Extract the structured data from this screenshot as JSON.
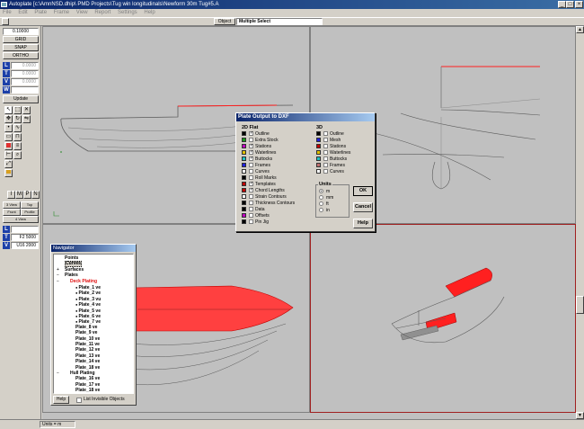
{
  "window": {
    "title": "Autoplate [c:\\AmnNSD.dhip\\ PMD Projects\\Tug win longitudinals\\Newform 30m Tug#5.A",
    "controls": [
      "_",
      "□",
      "×"
    ]
  },
  "menu": [
    "File",
    "Edit",
    "Plate",
    "Frame",
    "View",
    "Report",
    "Settings",
    "Help"
  ],
  "toolbar": {
    "object_label": "Object",
    "select_mode": "Multiple Select"
  },
  "left_panel": {
    "grid_value": "0.10000",
    "grid_label": "GRID",
    "snap_label": "SNAP",
    "ortho_label": "ORTHO",
    "axes": [
      {
        "label": "L",
        "value": "0.0000"
      },
      {
        "label": "T",
        "value": "0.0000"
      },
      {
        "label": "V",
        "value": "0.0000"
      },
      {
        "label": "W",
        "value": ""
      }
    ],
    "update_label": "Update",
    "view_buttons": [
      "I",
      "M",
      "P",
      "N"
    ],
    "views": [
      "3 View",
      "Top",
      "Front",
      "Profile",
      "4 View"
    ],
    "bottom_axes": [
      {
        "label": "L",
        "value": ""
      },
      {
        "label": "T",
        "value": "F2 5000"
      },
      {
        "label": "V",
        "value": "U16 2000"
      }
    ]
  },
  "dialog": {
    "title": "Plate Output to DXF",
    "group_2d": "2D Flat",
    "group_3d": "3D",
    "items_2d": [
      {
        "label": "Outline",
        "checked": true,
        "color": "#000000"
      },
      {
        "label": "Extra Stock",
        "checked": false,
        "color": "#1a9a1a"
      },
      {
        "label": "Stations",
        "checked": true,
        "color": "#c000c0"
      },
      {
        "label": "Waterlines",
        "checked": true,
        "color": "#e0c000"
      },
      {
        "label": "Buttocks",
        "checked": true,
        "color": "#20c0c0"
      },
      {
        "label": "Frames",
        "checked": false,
        "color": "#2020e0"
      },
      {
        "label": "Curves",
        "checked": false,
        "color": "#ffffff"
      },
      {
        "label": "Roll Marks",
        "checked": false,
        "color": "#000000"
      },
      {
        "label": "Templates",
        "checked": true,
        "color": "#c00000"
      },
      {
        "label": "Chord Lengths",
        "checked": true,
        "color": "#c00000"
      },
      {
        "label": "Strain Contours",
        "checked": false,
        "color": "#ffffff"
      },
      {
        "label": "Thickness Contours",
        "checked": false,
        "color": "#000000"
      },
      {
        "label": "Data",
        "checked": false,
        "color": "#000000"
      },
      {
        "label": "Offsets",
        "checked": false,
        "color": "#c000c0"
      },
      {
        "label": "Pin Jig",
        "checked": false,
        "color": "#000000"
      }
    ],
    "items_3d": [
      {
        "label": "Outline",
        "checked": false,
        "color": "#000000"
      },
      {
        "label": "Mesh",
        "checked": false,
        "color": "#2020e0"
      },
      {
        "label": "Stations",
        "checked": false,
        "color": "#c00000"
      },
      {
        "label": "Waterlines",
        "checked": false,
        "color": "#e0c000"
      },
      {
        "label": "Buttocks",
        "checked": false,
        "color": "#20c0c0"
      },
      {
        "label": "Frames",
        "checked": false,
        "color": "#c07070"
      },
      {
        "label": "Curves",
        "checked": false,
        "color": "#ffffff"
      }
    ],
    "units_label": "Units",
    "units": [
      {
        "label": "m",
        "selected": true
      },
      {
        "label": "mm",
        "selected": false
      },
      {
        "label": "ft",
        "selected": false
      },
      {
        "label": "in",
        "selected": false
      }
    ],
    "ok_label": "OK",
    "cancel_label": "Cancel",
    "help_label": "Help"
  },
  "navigator": {
    "title": "Navigator",
    "items": [
      {
        "label": "Points",
        "style": "normal",
        "prefix": "",
        "expander": ""
      },
      {
        "label": "Curves",
        "style": "selected",
        "prefix": "",
        "expander": ""
      },
      {
        "label": "Surfaces",
        "style": "normal",
        "prefix": "",
        "expander": "+"
      },
      {
        "label": "Plates",
        "style": "normal",
        "prefix": "",
        "expander": "−"
      },
      {
        "label": "Deck Plating",
        "style": "red",
        "prefix": "",
        "expander": "−"
      },
      {
        "label": "Plate_1 ve",
        "style": "normal",
        "prefix": "●",
        "expander": ""
      },
      {
        "label": "Plate_2 ve",
        "style": "normal",
        "prefix": "●",
        "expander": ""
      },
      {
        "label": "Plate_3 vu",
        "style": "normal",
        "prefix": "●",
        "expander": ""
      },
      {
        "label": "Plate_4 ve",
        "style": "normal",
        "prefix": "●",
        "expander": ""
      },
      {
        "label": "Plate_5 ve",
        "style": "normal",
        "prefix": "●",
        "expander": ""
      },
      {
        "label": "Plate_6 ve",
        "style": "normal",
        "prefix": "●",
        "expander": ""
      },
      {
        "label": "Plate_7 ve",
        "style": "normal",
        "prefix": "●",
        "expander": ""
      },
      {
        "label": "Plate_8 ve",
        "style": "normal",
        "prefix": "",
        "expander": ""
      },
      {
        "label": "Plate_9 ve",
        "style": "normal",
        "prefix": "",
        "expander": ""
      },
      {
        "label": "Plate_10 ve",
        "style": "normal",
        "prefix": "",
        "expander": ""
      },
      {
        "label": "Plate_11 ve",
        "style": "normal",
        "prefix": "",
        "expander": ""
      },
      {
        "label": "Plate_12 ve",
        "style": "normal",
        "prefix": "",
        "expander": ""
      },
      {
        "label": "Plate_13 ve",
        "style": "normal",
        "prefix": "",
        "expander": ""
      },
      {
        "label": "Plate_14 ve",
        "style": "normal",
        "prefix": "",
        "expander": ""
      },
      {
        "label": "Plate_18 ve",
        "style": "normal",
        "prefix": "",
        "expander": ""
      },
      {
        "label": "Hull Plating",
        "style": "normal",
        "prefix": "",
        "expander": "−"
      },
      {
        "label": "Plate_16 ve",
        "style": "normal",
        "prefix": "",
        "expander": ""
      },
      {
        "label": "Plate_17 ve",
        "style": "normal",
        "prefix": "",
        "expander": ""
      },
      {
        "label": "Plate_18 ve",
        "style": "normal",
        "prefix": "",
        "expander": ""
      }
    ],
    "help_label": "Help",
    "list_invisible_label": "List Invisible Objects"
  },
  "status": {
    "units": "Units = m"
  },
  "colors": {
    "viewport_bg": "#c0c0c0",
    "hull_line": "#5a5a5a",
    "deck_red": "#ff2020",
    "titlebar": "#0a246a"
  }
}
